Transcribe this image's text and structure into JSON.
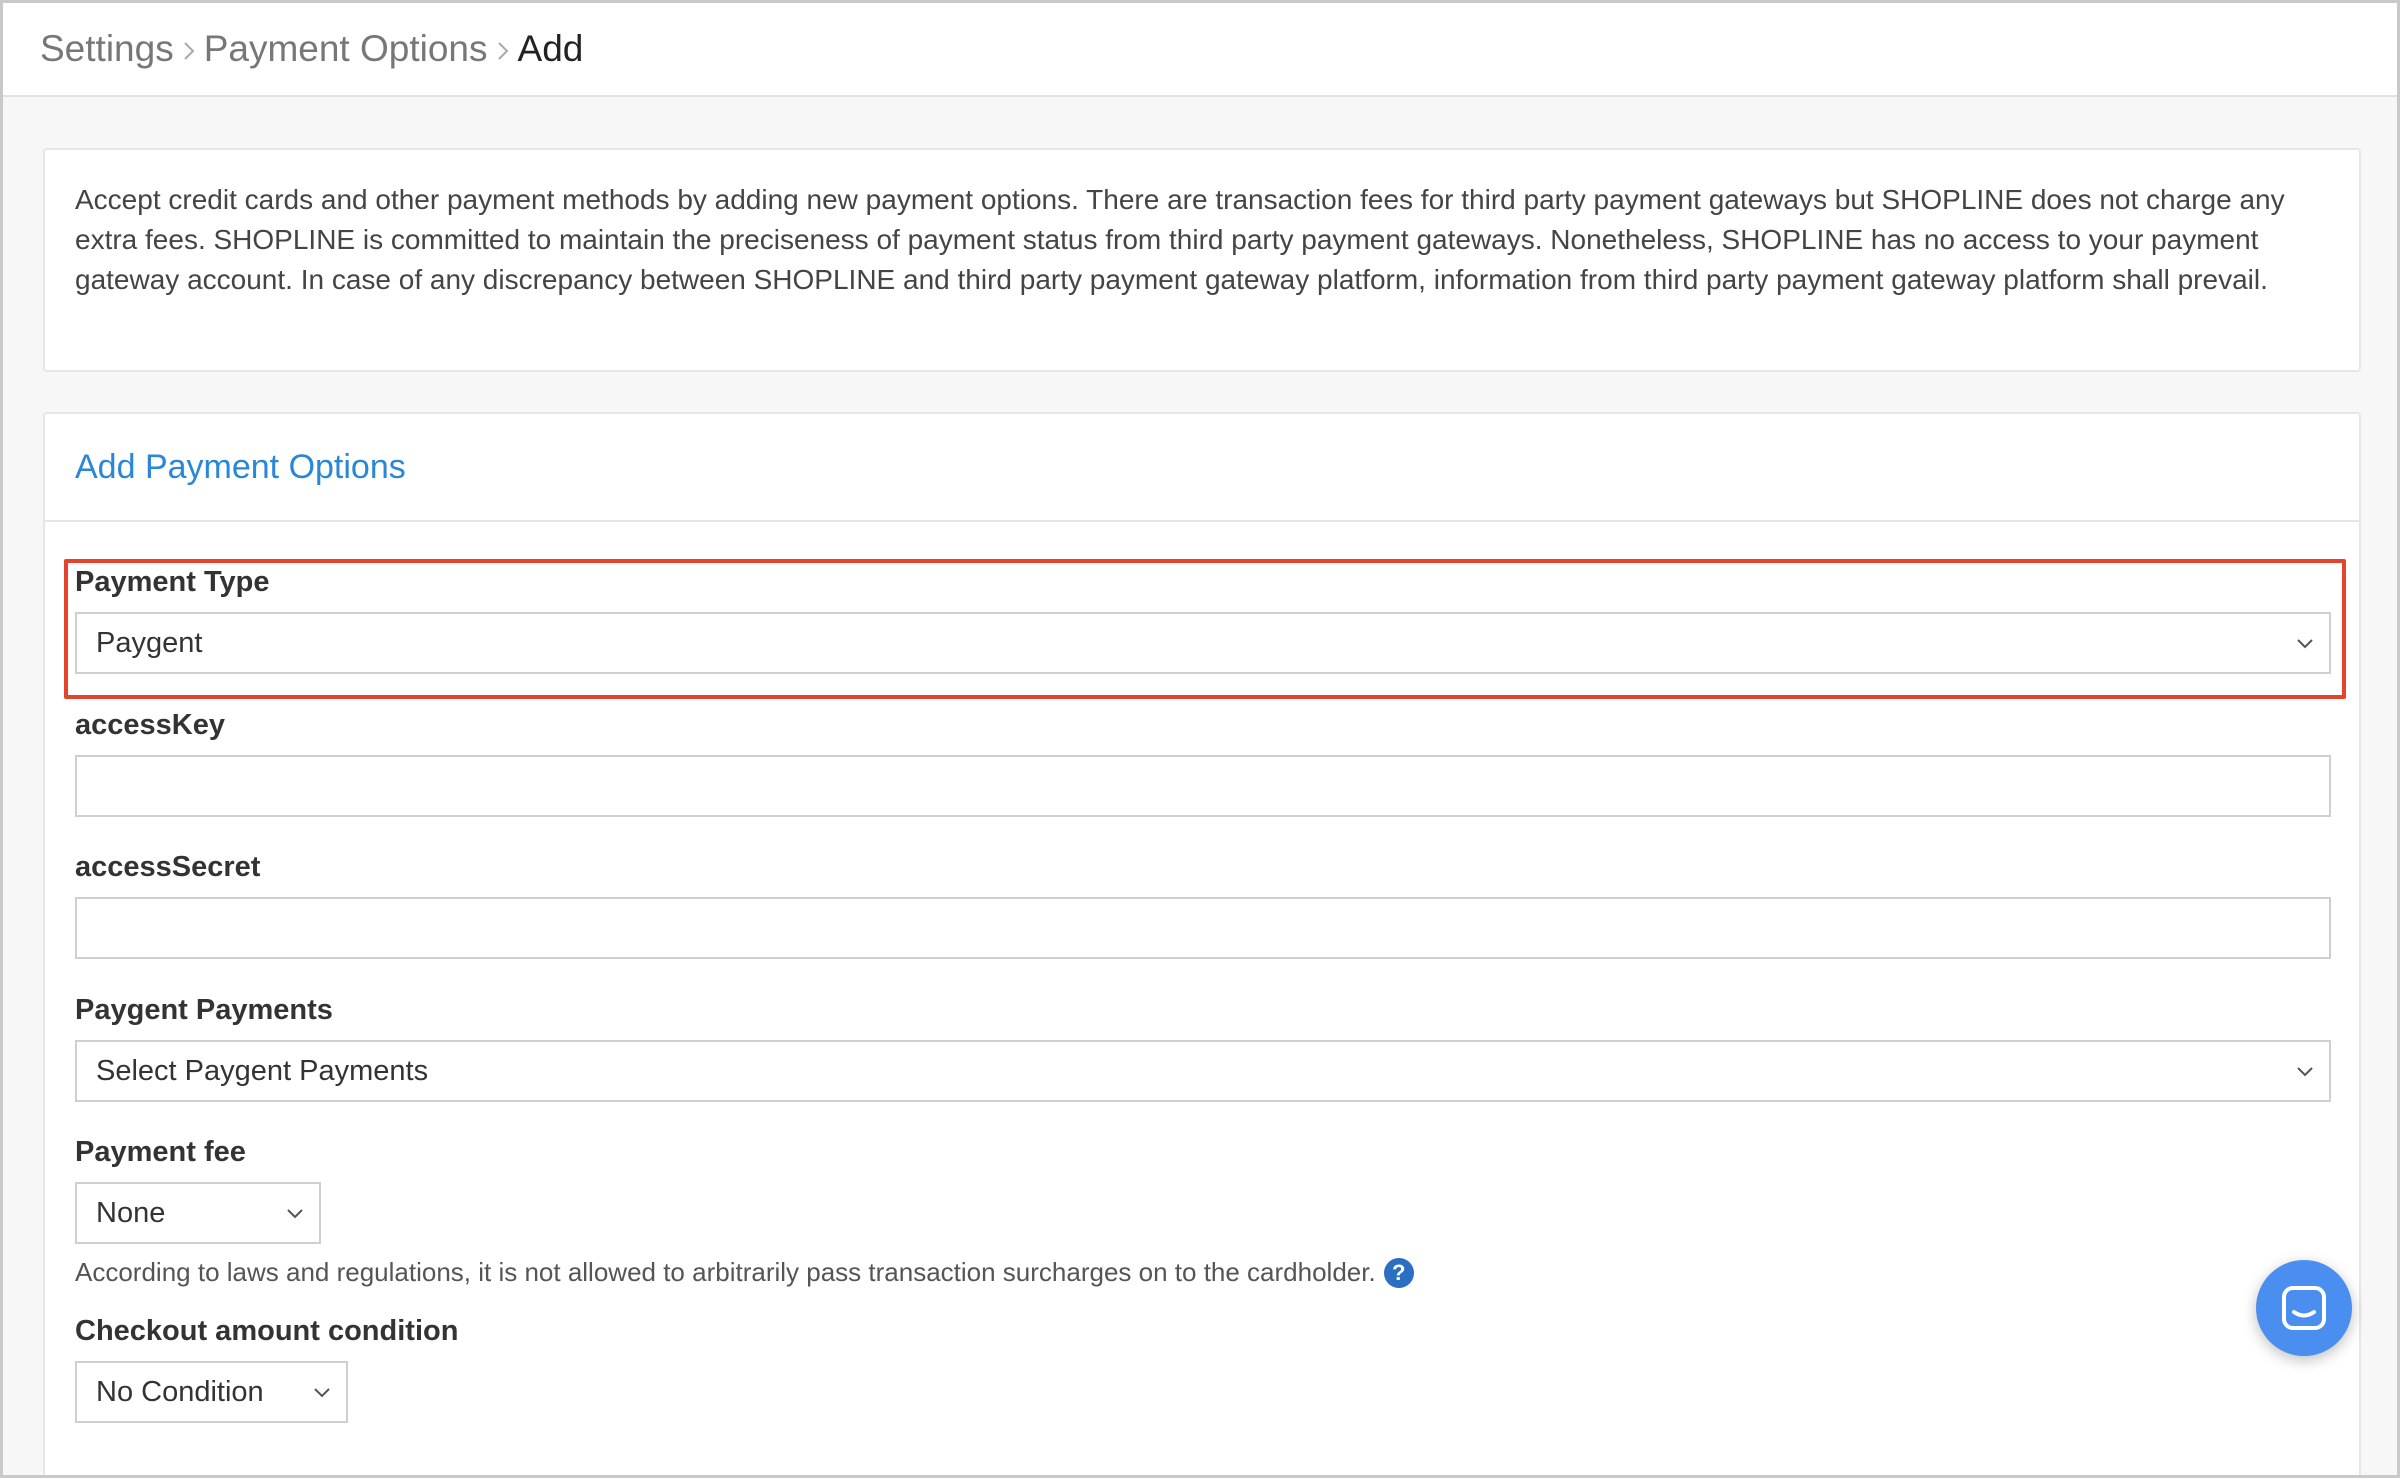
{
  "breadcrumb": {
    "items": [
      "Settings",
      "Payment Options"
    ],
    "current": "Add"
  },
  "info": {
    "text": "Accept credit cards and other payment methods by adding new payment options. There are transaction fees for third party payment gateways but SHOPLINE does not charge any extra fees. SHOPLINE is committed to maintain the preciseness of payment status from third party payment gateways. Nonetheless, SHOPLINE has no access to your payment gateway account. In case of any discrepancy between SHOPLINE and third party payment gateway platform, information from third party payment gateway platform shall prevail."
  },
  "form": {
    "title": "Add Payment Options",
    "payment_type": {
      "label": "Payment Type",
      "value": "Paygent"
    },
    "access_key": {
      "label": "accessKey",
      "value": ""
    },
    "access_secret": {
      "label": "accessSecret",
      "value": ""
    },
    "paygent_payments": {
      "label": "Paygent Payments",
      "value": "Select Paygent Payments"
    },
    "payment_fee": {
      "label": "Payment fee",
      "value": "None",
      "note": "According to laws and regulations, it is not allowed to arbitrarily pass transaction surcharges on to the cardholder."
    },
    "checkout_condition": {
      "label": "Checkout amount condition",
      "value": "No Condition"
    }
  },
  "colors": {
    "accent": "#2a86d6",
    "highlight": "#e2452b",
    "chat_button": "#4a8ef0",
    "help_icon": "#2b6fc2"
  },
  "icons": {
    "chevron": "chevron-down-icon",
    "help": "question-circle-icon",
    "chat": "chat-icon",
    "breadcrumb_separator": "chevron-right-icon"
  }
}
